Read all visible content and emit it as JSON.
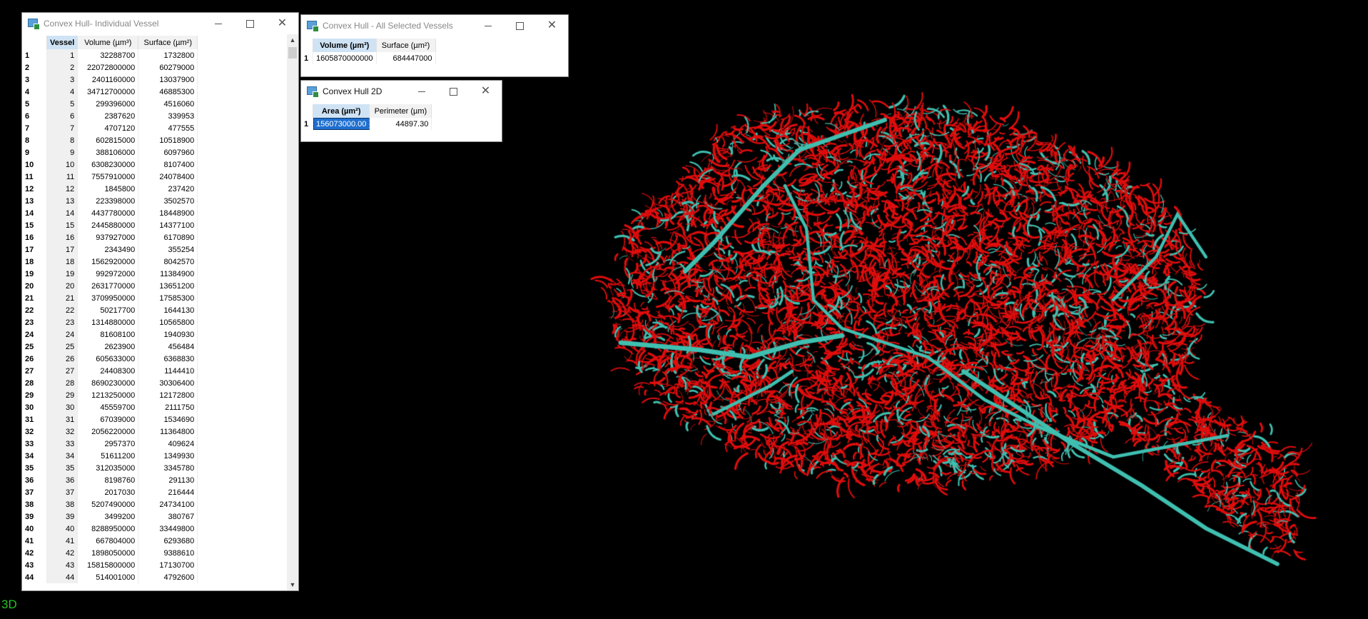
{
  "viewport": {
    "label": "3D"
  },
  "win_individual": {
    "title": "Convex Hull- Individual Vessel",
    "headers": [
      "Vessel",
      "Volume (µm³)",
      "Surface (µm²)"
    ],
    "rows": [
      [
        "1",
        "1",
        "32288700",
        "1732800"
      ],
      [
        "2",
        "2",
        "22072800000",
        "60279000"
      ],
      [
        "3",
        "3",
        "2401160000",
        "13037900"
      ],
      [
        "4",
        "4",
        "34712700000",
        "46885300"
      ],
      [
        "5",
        "5",
        "299396000",
        "4516060"
      ],
      [
        "6",
        "6",
        "2387620",
        "339953"
      ],
      [
        "7",
        "7",
        "4707120",
        "477555"
      ],
      [
        "8",
        "8",
        "602815000",
        "10518900"
      ],
      [
        "9",
        "9",
        "388106000",
        "6097960"
      ],
      [
        "10",
        "10",
        "6308230000",
        "8107400"
      ],
      [
        "11",
        "11",
        "7557910000",
        "24078400"
      ],
      [
        "12",
        "12",
        "1845800",
        "237420"
      ],
      [
        "13",
        "13",
        "223398000",
        "3502570"
      ],
      [
        "14",
        "14",
        "4437780000",
        "18448900"
      ],
      [
        "15",
        "15",
        "2445880000",
        "14377100"
      ],
      [
        "16",
        "16",
        "937927000",
        "6170890"
      ],
      [
        "17",
        "17",
        "2343490",
        "355254"
      ],
      [
        "18",
        "18",
        "1562920000",
        "8042570"
      ],
      [
        "19",
        "19",
        "992972000",
        "11384900"
      ],
      [
        "20",
        "20",
        "2631770000",
        "13651200"
      ],
      [
        "21",
        "21",
        "3709950000",
        "17585300"
      ],
      [
        "22",
        "22",
        "50217700",
        "1644130"
      ],
      [
        "23",
        "23",
        "1314880000",
        "10565800"
      ],
      [
        "24",
        "24",
        "81608100",
        "1940930"
      ],
      [
        "25",
        "25",
        "2623900",
        "456484"
      ],
      [
        "26",
        "26",
        "605633000",
        "6368830"
      ],
      [
        "27",
        "27",
        "24408300",
        "1144410"
      ],
      [
        "28",
        "28",
        "8690230000",
        "30306400"
      ],
      [
        "29",
        "29",
        "1213250000",
        "12172800"
      ],
      [
        "30",
        "30",
        "45559700",
        "2111750"
      ],
      [
        "31",
        "31",
        "67039000",
        "1534690"
      ],
      [
        "32",
        "32",
        "2056220000",
        "11364800"
      ],
      [
        "33",
        "33",
        "2957370",
        "409624"
      ],
      [
        "34",
        "34",
        "51611200",
        "1349930"
      ],
      [
        "35",
        "35",
        "312035000",
        "3345780"
      ],
      [
        "36",
        "36",
        "8198760",
        "291130"
      ],
      [
        "37",
        "37",
        "2017030",
        "216444"
      ],
      [
        "38",
        "38",
        "5207490000",
        "24734100"
      ],
      [
        "39",
        "39",
        "3499200",
        "380767"
      ],
      [
        "40",
        "40",
        "8288950000",
        "33449800"
      ],
      [
        "41",
        "41",
        "667804000",
        "6293680"
      ],
      [
        "42",
        "42",
        "1898050000",
        "9388610"
      ],
      [
        "43",
        "43",
        "15815800000",
        "17130700"
      ],
      [
        "44",
        "44",
        "514001000",
        "4792600"
      ]
    ]
  },
  "win_all": {
    "title": "Convex Hull - All Selected Vessels",
    "headers": [
      "Volume (µm³)",
      "Surface (µm²)"
    ],
    "row_index": "1",
    "values": [
      "1605870000000",
      "684447000"
    ]
  },
  "win_2d": {
    "title": "Convex Hull 2D",
    "headers": [
      "Area (µm²)",
      "Perimeter (µm)"
    ],
    "row_index": "1",
    "values": [
      "156073000.00",
      "44897.30"
    ]
  },
  "colors": {
    "vessel_red": "#e00d0d",
    "vessel_cyan": "#3fbfb0",
    "background": "#000000",
    "label_green": "#27c227"
  }
}
